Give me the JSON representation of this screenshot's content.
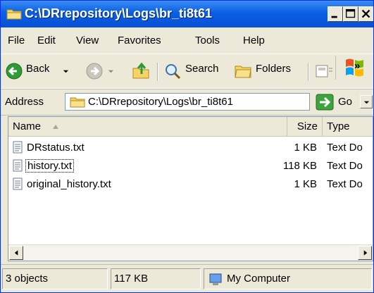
{
  "window": {
    "title": "C:\\DRrepository\\Logs\\br_ti8t61",
    "controls": {
      "minimize": "_",
      "maximize": "□",
      "close": "X"
    }
  },
  "menubar": {
    "items": [
      {
        "label": "File"
      },
      {
        "label": "Edit"
      },
      {
        "label": "View"
      },
      {
        "label": "Favorites"
      },
      {
        "label": "Tools"
      },
      {
        "label": "Help"
      }
    ]
  },
  "toolbar": {
    "back_label": "Back",
    "search_label": "Search",
    "folders_label": "Folders",
    "overflow_label": "»"
  },
  "address": {
    "label": "Address",
    "value": "C:\\DRrepository\\Logs\\br_ti8t61",
    "go_label": "Go"
  },
  "list": {
    "columns": {
      "name": "Name",
      "size": "Size",
      "type": "Type"
    },
    "rows": [
      {
        "name": "DRstatus.txt",
        "size": "1 KB",
        "type": "Text Do"
      },
      {
        "name": "history.txt",
        "size": "118 KB",
        "type": "Text Do"
      },
      {
        "name": "original_history.txt",
        "size": "1 KB",
        "type": "Text Do"
      }
    ]
  },
  "statusbar": {
    "objects": "3 objects",
    "size": "117 KB",
    "zone": "My Computer"
  },
  "colors": {
    "titlebar": "#0a5fe3",
    "chrome": "#ece9d8",
    "go_green": "#3da33d",
    "folder_yellow": "#f6d365"
  },
  "icons": [
    "folder-icon",
    "back-arrow-icon",
    "forward-arrow-icon",
    "up-folder-icon",
    "search-icon",
    "folders-icon",
    "text-file-icon",
    "computer-icon",
    "windows-logo-icon"
  ]
}
